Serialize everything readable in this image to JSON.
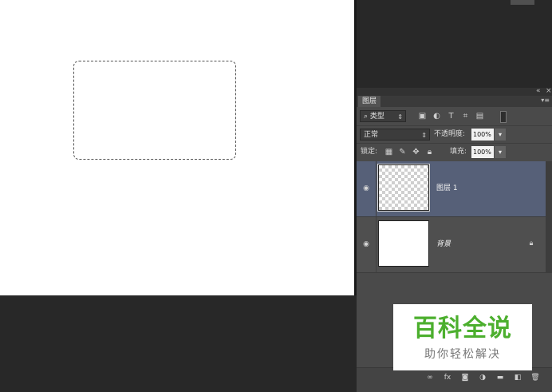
{
  "window": {
    "collapse_glyph": "«",
    "close_glyph": "×"
  },
  "layers_panel": {
    "tab_label": "图层",
    "panel_menu_icon": "panel-menu-icon",
    "filter": {
      "kind_label": "类型",
      "filter_icons": [
        "image-filter-icon",
        "adjustment-filter-icon",
        "type-filter-icon",
        "shape-filter-icon",
        "smart-object-filter-icon",
        "filter-toggle-icon"
      ]
    },
    "blend_mode": "正常",
    "opacity_label": "不透明度:",
    "opacity_value": "100%",
    "lock_label": "锁定:",
    "fill_label": "填充:",
    "fill_value": "100%",
    "layers": [
      {
        "name": "图层 1",
        "selected": true,
        "visible": true,
        "thumbnail": "transparent"
      },
      {
        "name": "背景",
        "selected": false,
        "visible": true,
        "locked": true,
        "thumbnail": "white"
      }
    ],
    "bottom_icons": [
      "link-layers-icon",
      "fx-icon",
      "layer-mask-icon",
      "adjustment-layer-icon",
      "group-folder-icon",
      "new-layer-icon",
      "delete-icon"
    ]
  },
  "watermark": {
    "title": "百科全说",
    "subtitle": "助你轻松解决"
  },
  "colors": {
    "workspace": "#282828",
    "panel": "#4a4a4a",
    "selected_layer": "#566078",
    "watermark_green": "#4caf2e"
  }
}
